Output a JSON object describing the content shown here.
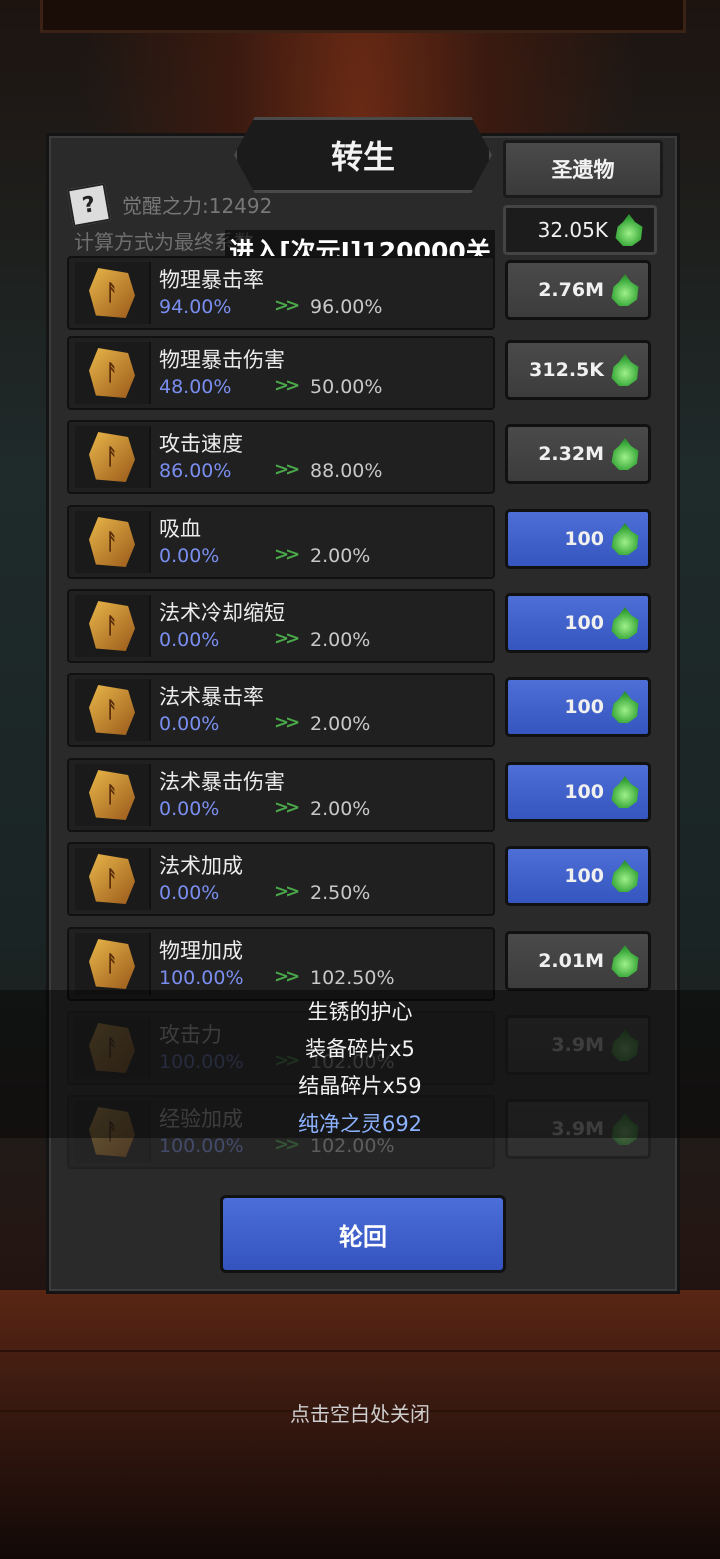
{
  "title": "转生",
  "relic_button": "圣遗物",
  "currency": "32.05K",
  "awaken": "觉醒之力:12492",
  "calc_note": "计算方式为最终系数",
  "toast": "进入[次元I]120000关",
  "rows": [
    {
      "name": "物理暴击率",
      "current": "94.00%",
      "next": "96.00%",
      "cost": "2.76M",
      "style": "gray"
    },
    {
      "name": "物理暴击伤害",
      "current": "48.00%",
      "next": "50.00%",
      "cost": "312.5K",
      "style": "gray"
    },
    {
      "name": "攻击速度",
      "current": "86.00%",
      "next": "88.00%",
      "cost": "2.32M",
      "style": "gray"
    },
    {
      "name": "吸血",
      "current": "0.00%",
      "next": "2.00%",
      "cost": "100",
      "style": "blue"
    },
    {
      "name": "法术冷却缩短",
      "current": "0.00%",
      "next": "2.00%",
      "cost": "100",
      "style": "blue"
    },
    {
      "name": "法术暴击率",
      "current": "0.00%",
      "next": "2.00%",
      "cost": "100",
      "style": "blue"
    },
    {
      "name": "法术暴击伤害",
      "current": "0.00%",
      "next": "2.00%",
      "cost": "100",
      "style": "blue"
    },
    {
      "name": "法术加成",
      "current": "0.00%",
      "next": "2.50%",
      "cost": "100",
      "style": "blue"
    },
    {
      "name": "物理加成",
      "current": "100.00%",
      "next": "102.50%",
      "cost": "2.01M",
      "style": "gray"
    },
    {
      "name": "攻击力",
      "current": "100.00%",
      "next": "102.00%",
      "cost": "3.9M",
      "style": "gray"
    },
    {
      "name": "经验加成",
      "current": "100.00%",
      "next": "102.00%",
      "cost": "3.9M",
      "style": "gray"
    }
  ],
  "rewards": [
    "生锈的护心",
    "装备碎片x5",
    "结晶碎片x59",
    "纯净之灵692"
  ],
  "cycle_button": "轮回",
  "close_hint": "点击空白处关闭",
  "colors": {
    "blue_button": "#4b6ed8",
    "current_value": "#7a8ef0",
    "arrow": "#4aa84a",
    "special_reward": "#8cb2ff"
  }
}
